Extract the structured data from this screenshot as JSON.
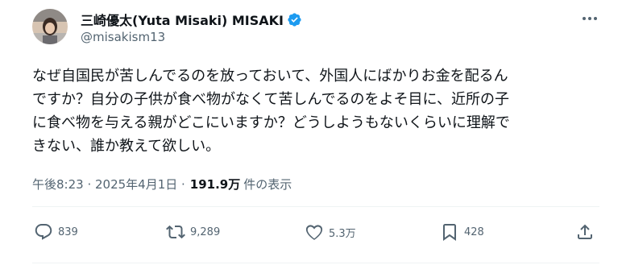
{
  "author": {
    "display_name": "三崎優太(Yuta Misaki) MISAKI",
    "handle": "@misakism13",
    "verified_color": "#1d9bf0"
  },
  "tweet": {
    "lines": [
      "なぜ自国民が苦しんでるのを放っておいて、外国人にばかりお金を配るん",
      "ですか？自分の子供が食べ物がなくて苦しんでるのをよそ目に、近所の子",
      "に食べ物を与える親がどこにいますか？どうしようもないくらいに理解で",
      "きない、誰か教えて欲しい。"
    ],
    "timestamp": "午後8:23 · 2025年4月1日 ·",
    "views_count": "191.9万",
    "views_label": "件の表示"
  },
  "actions": {
    "replies": "839",
    "retweets": "9,289",
    "likes": "5.3万",
    "bookmarks": "428"
  },
  "icons": [
    "more-icon",
    "verified-icon",
    "reply-icon",
    "retweet-icon",
    "like-icon",
    "bookmark-icon",
    "share-icon"
  ]
}
